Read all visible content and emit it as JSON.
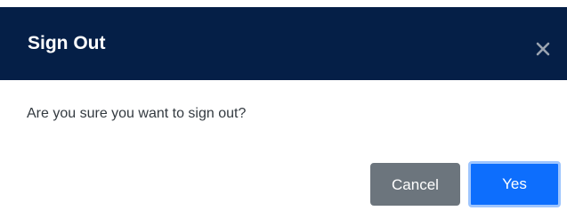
{
  "dialog": {
    "title": "Sign Out",
    "close_icon": "close-icon",
    "message": "Are you sure you want to sign out?",
    "cancel_label": "Cancel",
    "yes_label": "Yes"
  },
  "colors": {
    "header_background": "#051f47",
    "primary": "#0d6efd",
    "secondary": "#6c757d"
  }
}
